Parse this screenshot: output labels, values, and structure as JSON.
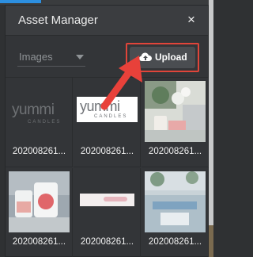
{
  "modal": {
    "title": "Asset Manager",
    "close_glyph": "×"
  },
  "toolbar": {
    "filter_value": "Images",
    "upload_label": "Upload",
    "upload_icon": "cloud-upload-icon"
  },
  "assets": [
    {
      "filename": "202008261...",
      "brand": "yummi",
      "sub": "CANDLES"
    },
    {
      "filename": "202008261...",
      "brand": "yummi",
      "sub": "CANDLES"
    },
    {
      "filename": "202008261..."
    },
    {
      "filename": "202008261..."
    },
    {
      "filename": "202008261..."
    },
    {
      "filename": "202008261..."
    }
  ],
  "colors": {
    "accent_blue": "#2c8fe0",
    "highlight_red": "#e0453a"
  }
}
